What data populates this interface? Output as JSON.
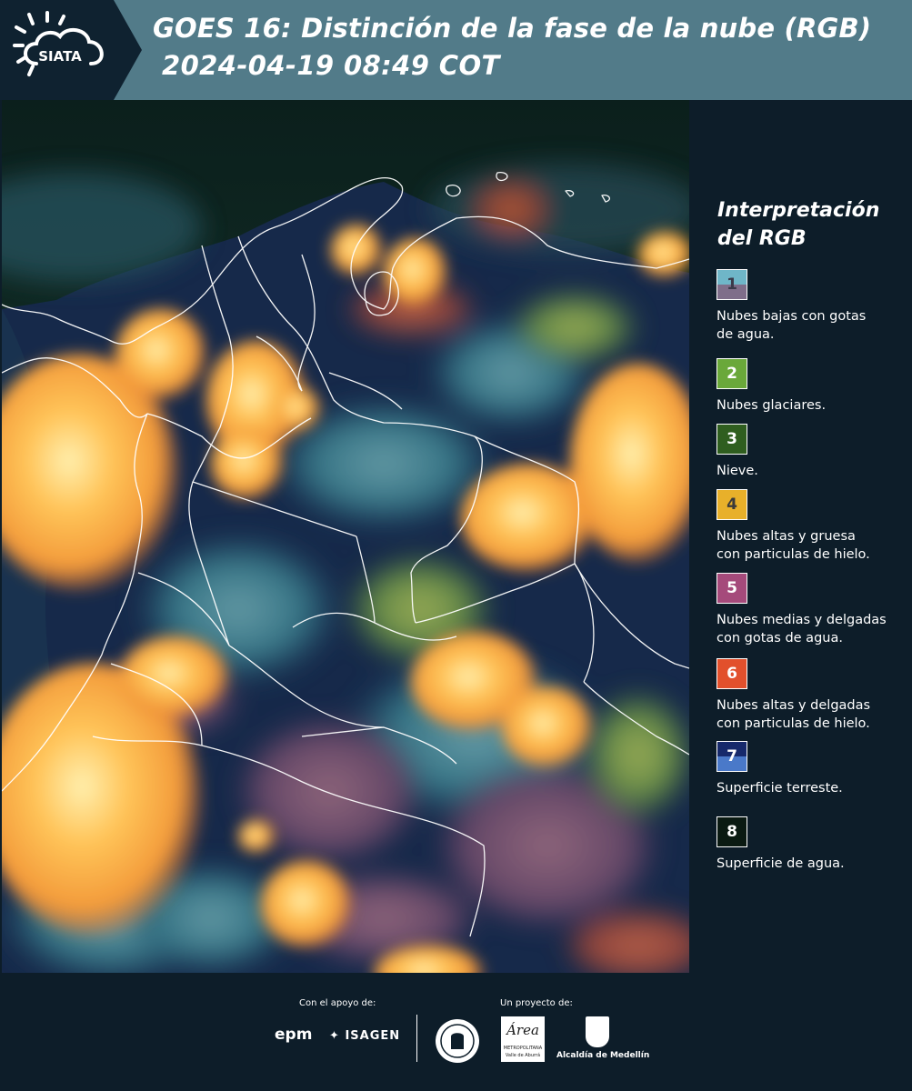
{
  "header": {
    "logo_text": "SIATA",
    "title_line1": "GOES 16: Distinción de la fase de la nube (RGB)",
    "title_line2": "2024-04-19 08:49 COT"
  },
  "legend": {
    "title_line1": "Interpretación",
    "title_line2": "del RGB",
    "items": [
      {
        "number": "1",
        "colors": [
          "#6fb6c8",
          "#7f6e8a"
        ],
        "number_color": "#3a3a4a",
        "text_lines": [
          "Nubes bajas con gotas",
          "de agua."
        ]
      },
      {
        "number": "2",
        "colors": [
          "#6aa83a"
        ],
        "number_color": "#ffffff",
        "text_lines": [
          "Nubes glaciares."
        ]
      },
      {
        "number": "3",
        "colors": [
          "#2f5e1f"
        ],
        "number_color": "#ffffff",
        "text_lines": [
          "Nieve."
        ]
      },
      {
        "number": "4",
        "colors": [
          "#e8b02a"
        ],
        "number_color": "#3a3a3a",
        "text_lines": [
          "Nubes altas y gruesa",
          "con particulas de hielo."
        ]
      },
      {
        "number": "5",
        "colors": [
          "#a54a7b"
        ],
        "number_color": "#ffffff",
        "text_lines": [
          "Nubes medias y delgadas",
          "con gotas de agua."
        ]
      },
      {
        "number": "6",
        "colors": [
          "#e2502c"
        ],
        "number_color": "#ffffff",
        "text_lines": [
          "Nubes altas y delgadas",
          "con particulas de hielo."
        ]
      },
      {
        "number": "7",
        "colors": [
          "#16296b",
          "#4a79c9"
        ],
        "number_color": "#ffffff",
        "text_lines": [
          "Superficie terreste."
        ]
      },
      {
        "number": "8",
        "colors": [
          "#0a1a12"
        ],
        "number_color": "#ffffff",
        "text_lines": [
          "Superficie de agua."
        ]
      }
    ]
  },
  "footer": {
    "support_label": "Con el apoyo de:",
    "project_label": "Un proyecto de:",
    "sponsor_epm": "epm",
    "sponsor_isagen": "ISAGEN",
    "amva_name": "Área",
    "amva_sub1": "METROPOLITANA",
    "amva_sub2": "Valle de Aburrá",
    "medellin_name": "Alcaldía de Medellín"
  }
}
